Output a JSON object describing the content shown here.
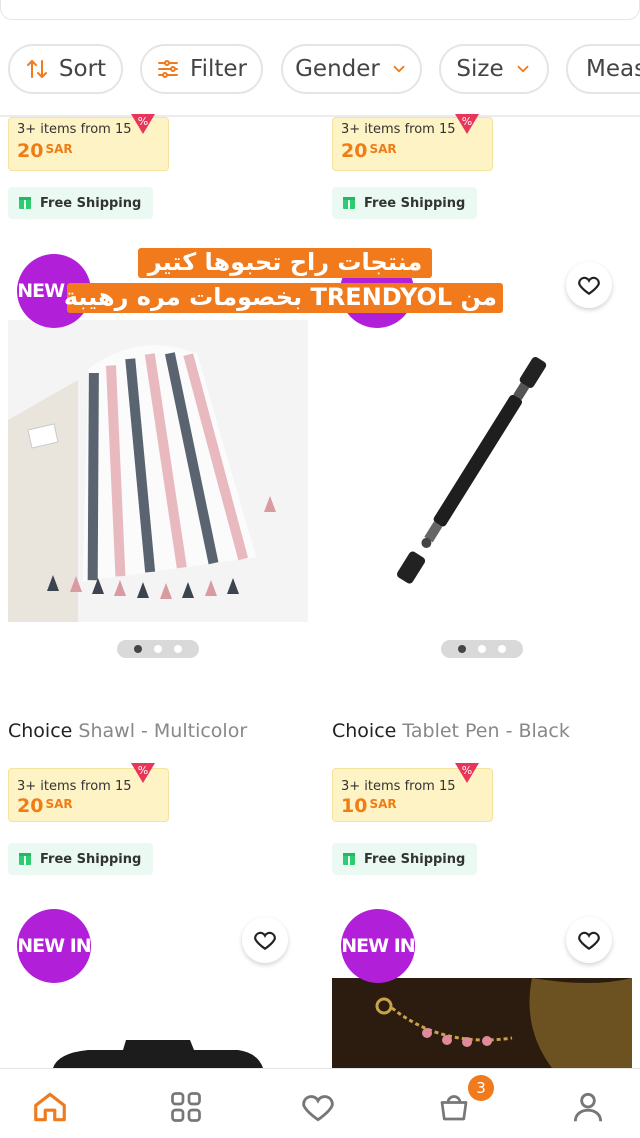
{
  "filters": {
    "sort": "Sort",
    "filter": "Filter",
    "gender": "Gender",
    "size": "Size",
    "meas": "Meas"
  },
  "overlay": {
    "line1": "منتجات راح تحبوها كتير",
    "line2": "من TRENDYOL بخصومات مره رهيبة"
  },
  "top_row": [
    {
      "promo_text": "3+ items from 15",
      "price": "20",
      "currency": "SAR",
      "shipping": "Free Shipping"
    },
    {
      "promo_text": "3+ items from 15",
      "price": "20",
      "currency": "SAR",
      "shipping": "Free Shipping"
    }
  ],
  "products": [
    {
      "badge": "NEW IN",
      "brand": "Choice",
      "name": "Shawl - Multicolor",
      "promo_text": "3+ items from 15",
      "price": "20",
      "currency": "SAR",
      "shipping": "Free Shipping",
      "image": "striped-scarf"
    },
    {
      "badge": "NEW IN",
      "brand": "Choice",
      "name": "Tablet Pen - Black",
      "promo_text": "3+ items from 15",
      "price": "10",
      "currency": "SAR",
      "shipping": "Free Shipping",
      "image": "stylus-pen"
    }
  ],
  "next_row": [
    {
      "badge": "NEW IN",
      "image": "black-belt"
    },
    {
      "badge": "NEW IN",
      "image": "bracelet"
    }
  ],
  "bottom_nav": {
    "items": [
      "home-icon",
      "categories-icon",
      "favorites-icon",
      "cart-icon",
      "profile-icon"
    ],
    "cart_count": "3",
    "accent": "#f07a1c"
  },
  "colors": {
    "accent": "#f07a1c",
    "badge": "#b21fd8",
    "promo_bg": "#fdf3c4",
    "shipping_bg": "#eafaf2"
  }
}
